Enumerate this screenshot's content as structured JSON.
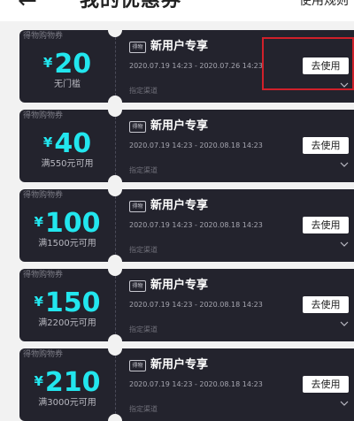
{
  "header": {
    "back_icon": "←",
    "title": "我的优惠券",
    "rules_link": "使用规则"
  },
  "coupons": [
    {
      "type_label": "得物购物券",
      "currency": "¥",
      "amount": "20",
      "condition": "无门槛",
      "badge": "得物",
      "title": "新用户专享",
      "validity": "2020.07.19 14:23 - 2020.07.26 14:23",
      "button_label": "去使用",
      "channel": "指定渠道"
    },
    {
      "type_label": "得物购物券",
      "currency": "¥",
      "amount": "40",
      "condition": "满550元可用",
      "badge": "得物",
      "title": "新用户专享",
      "validity": "2020.07.19 14:23 - 2020.08.18 14:23",
      "button_label": "去使用",
      "channel": "指定渠道"
    },
    {
      "type_label": "得物购物券",
      "currency": "¥",
      "amount": "100",
      "condition": "满1500元可用",
      "badge": "得物",
      "title": "新用户专享",
      "validity": "2020.07.19 14:23 - 2020.08.18 14:23",
      "button_label": "去使用",
      "channel": "指定渠道"
    },
    {
      "type_label": "得物购物券",
      "currency": "¥",
      "amount": "150",
      "condition": "满2200元可用",
      "badge": "得物",
      "title": "新用户专享",
      "validity": "2020.07.19 14:23 - 2020.08.18 14:23",
      "button_label": "去使用",
      "channel": "指定渠道"
    },
    {
      "type_label": "得物购物券",
      "currency": "¥",
      "amount": "210",
      "condition": "满3000元可用",
      "badge": "得物",
      "title": "新用户专享",
      "validity": "2020.07.19 14:23 - 2020.08.18 14:23",
      "button_label": "去使用",
      "channel": "指定渠道"
    }
  ],
  "colors": {
    "card_background": "#23232d",
    "amount": "#22e6ee",
    "page_background": "#f2f2f2",
    "highlight": "#d0202a"
  }
}
